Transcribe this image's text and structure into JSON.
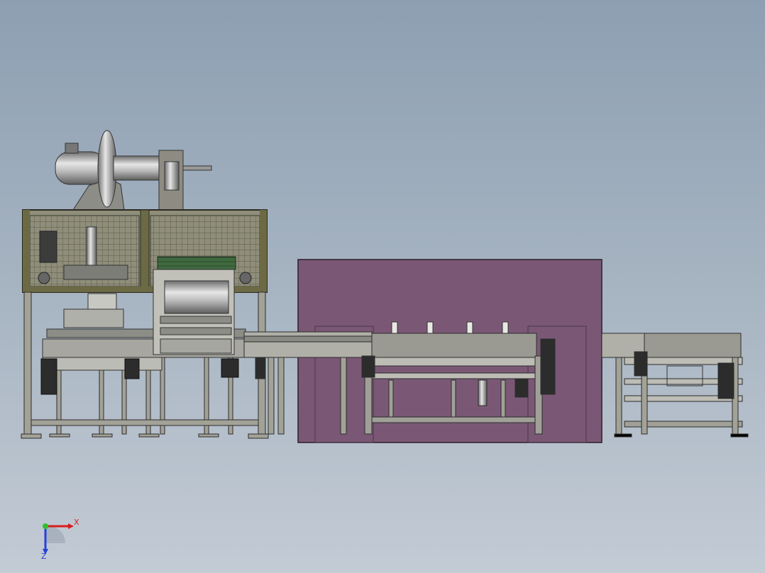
{
  "viewport": {
    "background_top": "#8d9fb2",
    "background_bottom": "#c3cbd5"
  },
  "model": {
    "frame_color": "#6e6d5f",
    "panel_color": "#7a5875",
    "steel_color": "#9a9a92",
    "guard_color": "#6c6a44"
  },
  "triad": {
    "x_label": "X",
    "z_label": "Z",
    "x_color": "#d81e1e",
    "y_color": "#2fbf2f",
    "z_color": "#2442d8"
  }
}
